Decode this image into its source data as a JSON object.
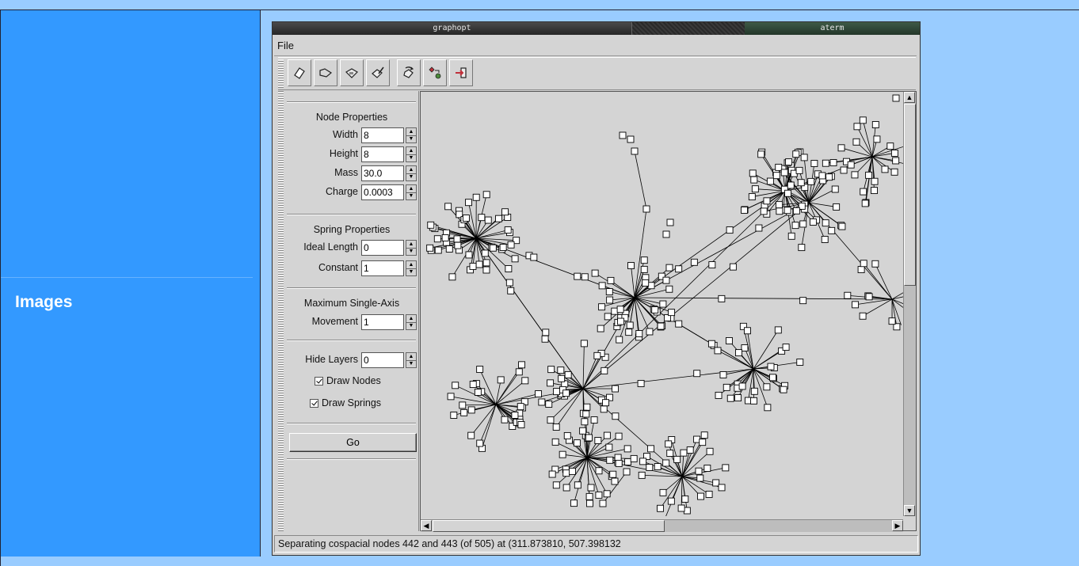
{
  "page": {
    "section_label": "Images"
  },
  "window": {
    "title": "graphopt",
    "other_title": "aterm",
    "menu": [
      "File"
    ]
  },
  "toolbar": {
    "buttons": [
      "new-icon",
      "open-icon",
      "save-icon",
      "clear-icon",
      "reload-icon",
      "layout-icon",
      "exit-icon"
    ]
  },
  "panel": {
    "node_properties": {
      "title": "Node Properties",
      "width_label": "Width",
      "width_value": "8",
      "height_label": "Height",
      "height_value": "8",
      "mass_label": "Mass",
      "mass_value": "30.0",
      "charge_label": "Charge",
      "charge_value": "0.0003"
    },
    "spring_properties": {
      "title": "Spring Properties",
      "ideal_length_label": "Ideal Length",
      "ideal_length_value": "0",
      "constant_label": "Constant",
      "constant_value": "1"
    },
    "movement": {
      "title": "Maximum Single-Axis",
      "movement_label": "Movement",
      "movement_value": "1"
    },
    "display": {
      "hide_layers_label": "Hide Layers",
      "hide_layers_value": "0",
      "draw_nodes_label": "Draw Nodes",
      "draw_nodes_checked": true,
      "draw_springs_label": "Draw Springs",
      "draw_springs_checked": true
    },
    "go_label": "Go"
  },
  "status": {
    "text": "Separating cospacial nodes 442 and 443 (of 505) at (311.873810, 507.398132"
  }
}
